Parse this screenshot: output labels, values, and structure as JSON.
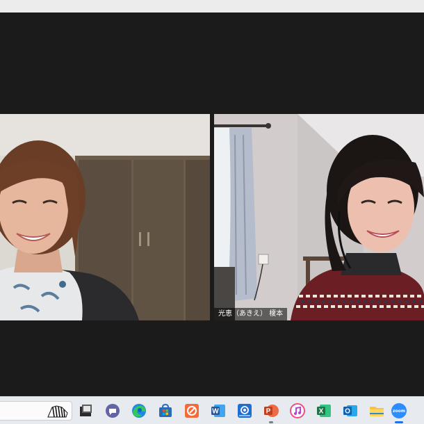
{
  "meeting": {
    "participants": [
      {
        "id": "left",
        "name": ""
      },
      {
        "id": "right",
        "name": "光恵（あきえ） 榎本"
      }
    ]
  },
  "taskbar": {
    "icons": [
      "snipping-tool-icon",
      "teams-chat-icon",
      "edge-browser-icon",
      "microsoft-store-icon",
      "snip-sketch-icon",
      "word-icon",
      "email-app-icon",
      "powerpoint-icon",
      "itunes-icon",
      "excel-icon",
      "outlook-icon",
      "file-explorer-icon",
      "zoom-icon"
    ],
    "zoom_label": "zoom",
    "word_letter": "W",
    "powerpoint_letter": "P",
    "excel_letter": "X",
    "outlook_letter": "O"
  },
  "colors": {
    "zoom_blue": "#2d8cff",
    "word_blue": "#2b579a",
    "excel_green": "#217346",
    "powerpoint_orange": "#d24726",
    "outlook_blue": "#0a64b8",
    "taskbar_bg": "#e7eaee"
  }
}
